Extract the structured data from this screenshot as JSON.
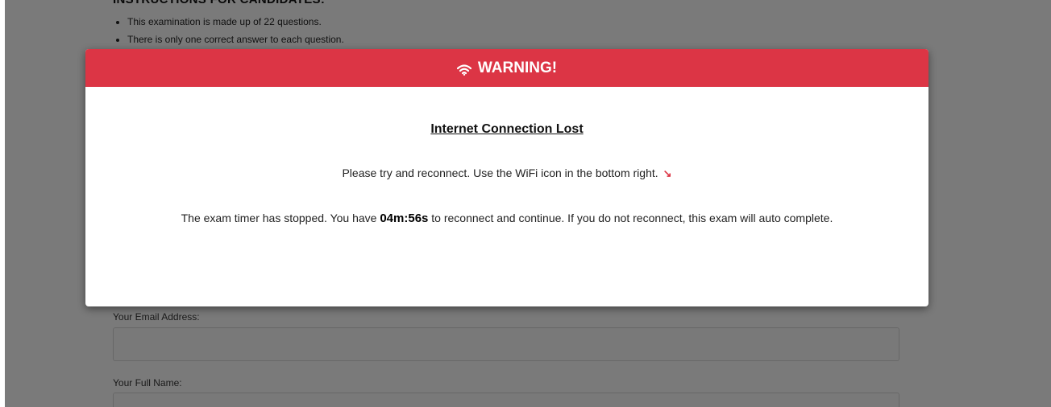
{
  "background": {
    "instructions_heading": "INSTRUCTIONS FOR CANDIDATES:",
    "instructions": [
      "This examination is made up of 22 questions.",
      "There is only one correct answer to each question."
    ],
    "email_label": "Your Email Address:",
    "email_value": "",
    "name_label": "Your Full Name:",
    "name_value": ""
  },
  "modal": {
    "header_icon": "wifi-icon",
    "header_title": "WARNING!",
    "title": "Internet Connection Lost",
    "line1": "Please try and reconnect. Use the WiFi icon in the bottom right.",
    "line1_icon": "arrow-down-right-icon",
    "line2_before": "The exam timer has stopped. You have ",
    "timer": "04m:56s",
    "line2_after": " to reconnect and continue. If you do not reconnect, this exam will auto complete.",
    "accent_color": "#dc3545"
  }
}
